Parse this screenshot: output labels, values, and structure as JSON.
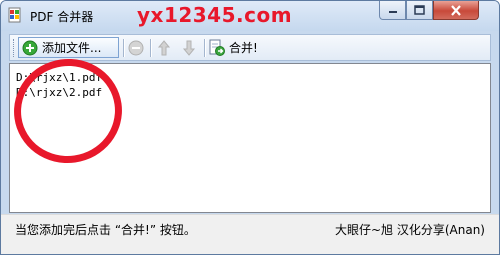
{
  "window": {
    "title": "PDF 合并器",
    "watermark": "yx12345.com"
  },
  "toolbar": {
    "add_files_label": "添加文件...",
    "merge_label": "合并!",
    "icons": [
      "add-file-icon",
      "remove-icon",
      "move-up-icon",
      "move-down-icon",
      "merge-icon"
    ]
  },
  "file_list": {
    "items": [
      "D:\\rjxz\\1.pdf",
      "D:\\rjxz\\2.pdf"
    ]
  },
  "status": {
    "left_text": "当您添加完后点击 “合并!” 按钮。",
    "right_text": "大眼仔~旭 汉化分享(Anan)"
  },
  "colors": {
    "title_bar": "#c5d8ee",
    "close_button": "#c8493a",
    "annotation_circle": "#e8182b",
    "watermark": "#e8182b"
  }
}
